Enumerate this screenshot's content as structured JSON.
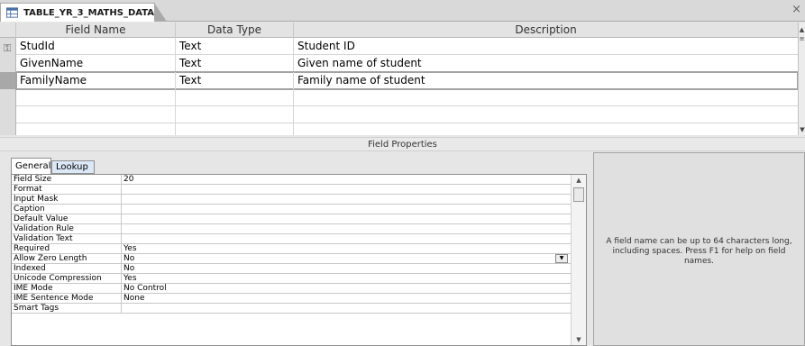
{
  "tab": {
    "title": "TABLE_YR_3_MATHS_DATA",
    "icon": "table-icon",
    "close_glyph": "×"
  },
  "grid": {
    "headers": [
      "Field Name",
      "Data Type",
      "Description"
    ],
    "rows": [
      {
        "field_name": "StudId",
        "data_type": "Text",
        "description": "Student ID",
        "primary_key": true
      },
      {
        "field_name": "GivenName",
        "data_type": "Text",
        "description": "Given name of student",
        "primary_key": false
      },
      {
        "field_name": "FamilyName",
        "data_type": "Text",
        "description": "Family name of student",
        "primary_key": false,
        "current": true
      }
    ],
    "empty_rows": 3
  },
  "field_properties_title": "Field Properties",
  "prop_tabs": {
    "general": "General",
    "lookup": "Lookup"
  },
  "properties": [
    {
      "name": "Field Size",
      "value": "20"
    },
    {
      "name": "Format",
      "value": ""
    },
    {
      "name": "Input Mask",
      "value": ""
    },
    {
      "name": "Caption",
      "value": ""
    },
    {
      "name": "Default Value",
      "value": ""
    },
    {
      "name": "Validation Rule",
      "value": ""
    },
    {
      "name": "Validation Text",
      "value": ""
    },
    {
      "name": "Required",
      "value": "Yes"
    },
    {
      "name": "Allow Zero Length",
      "value": "No",
      "dropdown": true
    },
    {
      "name": "Indexed",
      "value": "No"
    },
    {
      "name": "Unicode Compression",
      "value": "Yes"
    },
    {
      "name": "IME Mode",
      "value": "No Control"
    },
    {
      "name": "IME Sentence Mode",
      "value": "None"
    },
    {
      "name": "Smart Tags",
      "value": ""
    }
  ],
  "help_text": "A field name can be up to 64 characters long, including spaces. Press F1 for help on field names.",
  "colors": {
    "grid_bg": "#ffffff",
    "panel_bg": "#e6e6e6",
    "lookup_tab": "#dbe8f7"
  }
}
